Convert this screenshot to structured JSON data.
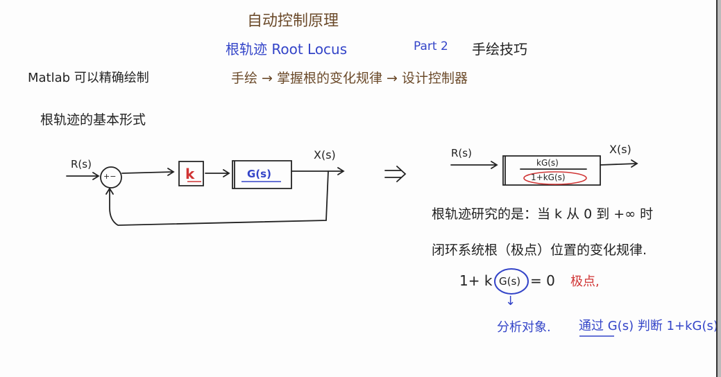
{
  "header": {
    "title": "自动控制原理",
    "topic": "根轨迹 Root Locus",
    "part": "Part 2",
    "subtitle": "手绘技巧",
    "flow": "手绘 → 掌握根的变化规律 → 设计控制器"
  },
  "left_notes": {
    "matlab": "Matlab 可以精确绘制",
    "basic_form": "根轨迹的基本形式"
  },
  "block_diagram": {
    "input": "R(s)",
    "summer_sign": "+−",
    "gain": "k",
    "plant": "G(s)",
    "output": "X(s)"
  },
  "equivalent": {
    "implies": "⇒",
    "input": "R(s)",
    "numerator": "kG(s)",
    "denominator": "1+kG(s)",
    "output": "X(s)"
  },
  "right_notes": {
    "line1": "根轨迹研究的是：当 k 从 0 到 +∞ 时",
    "line2": "闭环系统根（极点）位置的变化规律.",
    "equation_prefix": "1+ k",
    "equation_g": "G(s)",
    "equation_suffix": "= 0",
    "poles_label": "极点,",
    "down_arrow": "↓",
    "analysis": "分析对象.",
    "via": "通过 G(s) 判断 1+kG(s)"
  },
  "colors": {
    "brown": "#6b4a2a",
    "blue": "#3344c8",
    "red": "#d03434",
    "ink": "#222222"
  }
}
